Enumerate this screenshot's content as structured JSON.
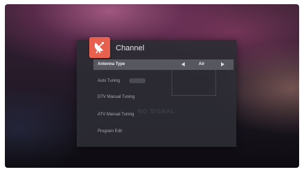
{
  "menu": {
    "title": "Channel",
    "icon": "satellite-dish-icon",
    "accent_color": "#e8604e",
    "items": [
      {
        "label": "Antenna Type",
        "value": "Air",
        "selected": true
      },
      {
        "label": "Auto Tuning"
      },
      {
        "label": "DTV Manual Tuning"
      },
      {
        "label": "ATV Manual Tuning"
      },
      {
        "label": "Program Edit"
      }
    ]
  },
  "background": {
    "ghost_text": "NO SIGNAL"
  }
}
